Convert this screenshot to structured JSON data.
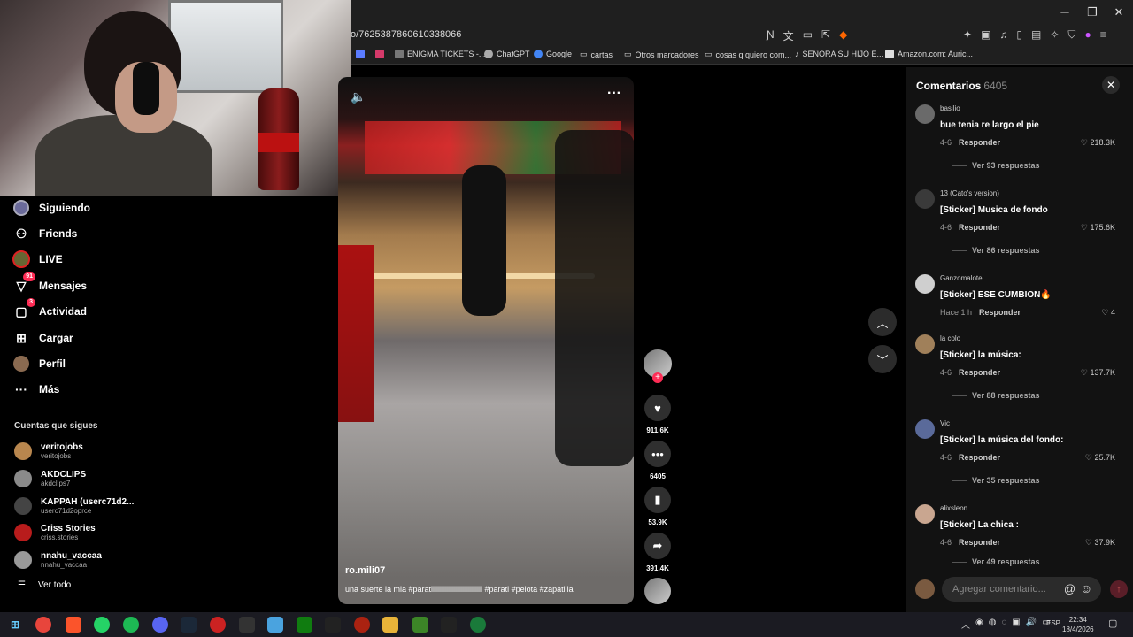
{
  "browser": {
    "url": "o/7625387860610338066",
    "window_controls": [
      "─",
      "❐",
      "✕"
    ],
    "bookmarks": [
      "ENIGMA TICKETS -...",
      "ChatGPT",
      "Google",
      "cartas",
      "Otros marcadores",
      "cosas q quiero com...",
      "SEÑORA SU HIJO E...",
      "Amazon.com: Auric..."
    ]
  },
  "sidebar": {
    "nav": [
      {
        "label": "Siguiendo",
        "icon": "following-avatar-icon"
      },
      {
        "label": "Friends",
        "icon": "friends-icon"
      },
      {
        "label": "LIVE",
        "icon": "live-icon"
      },
      {
        "label": "Mensajes",
        "icon": "messages-icon",
        "badge": "91"
      },
      {
        "label": "Actividad",
        "icon": "activity-icon",
        "badge": "3"
      },
      {
        "label": "Cargar",
        "icon": "upload-icon"
      },
      {
        "label": "Perfil",
        "icon": "profile-icon"
      },
      {
        "label": "Más",
        "icon": "more-icon"
      }
    ],
    "following_title": "Cuentas que sigues",
    "accounts": [
      {
        "name": "veritojobs",
        "handle": "veritojobs",
        "color": "#b8864e"
      },
      {
        "name": "AKDCLIPS",
        "handle": "akdclips7",
        "color": "#8a8a8a"
      },
      {
        "name": "KAPPAH (userc71d2...",
        "handle": "userc71d2oprce",
        "color": "#444"
      },
      {
        "name": "Criss Stories",
        "handle": "criss.stories",
        "color": "#b81c1c"
      },
      {
        "name": "nnahu_vaccaa",
        "handle": "nnahu_vaccaa",
        "color": "#999"
      }
    ],
    "see_all": "Ver todo"
  },
  "video": {
    "author": "ro.mili07",
    "description": "una suerte la mia #paratiiiiiiiiiiiiiiiiiiiiiiiiiiiii #parati #pelota #zapatilla",
    "likes": "911.6K",
    "comments": "6405",
    "saves": "53.9K",
    "shares": "391.4K"
  },
  "comments_panel": {
    "title": "Comentarios",
    "count": "6405",
    "items": [
      {
        "user": "basilio",
        "text": "bue tenia re largo el pie",
        "date": "4-6",
        "reply": "Responder",
        "likes": "218.3K",
        "replies": "Ver 93 respuestas",
        "color": "#6a6a6a"
      },
      {
        "user": "13 (Cato's version)",
        "text": "[Sticker] Musica de fondo",
        "date": "4-6",
        "reply": "Responder",
        "likes": "175.6K",
        "replies": "Ver 86 respuestas",
        "color": "#3a3a3a"
      },
      {
        "user": "Ganzomalote",
        "text": "[Sticker] ESE CUMBION🔥",
        "date": "Hace 1 h",
        "reply": "Responder",
        "likes": "4",
        "replies": "",
        "color": "#cfcfcf"
      },
      {
        "user": "la colo",
        "text": "[Sticker] la música:",
        "date": "4-6",
        "reply": "Responder",
        "likes": "137.7K",
        "replies": "Ver 88 respuestas",
        "color": "#a0805a"
      },
      {
        "user": "Vic",
        "text": "[Sticker] la música del fondo:",
        "date": "4-6",
        "reply": "Responder",
        "likes": "25.7K",
        "replies": "Ver 35 respuestas",
        "color": "#5a6a9a"
      },
      {
        "user": "alixsleon",
        "text": "[Sticker] La chica :",
        "date": "4-6",
        "reply": "Responder",
        "likes": "37.9K",
        "replies": "Ver 49 respuestas",
        "color": "#c9a690"
      }
    ],
    "input_placeholder": "Agregar comentario..."
  },
  "taskbar": {
    "language": "ESP",
    "time": "22:34",
    "date": "18/4/2026"
  },
  "colors": {
    "accent": "#fe2c55",
    "panel": "#121212"
  }
}
